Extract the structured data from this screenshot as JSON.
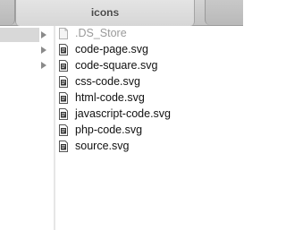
{
  "window": {
    "title": "icons"
  },
  "files": [
    {
      "name": ".DS_Store",
      "hidden": true,
      "icon": "blank-document-icon"
    },
    {
      "name": "code-page.svg",
      "hidden": false,
      "icon": "svg-document-icon"
    },
    {
      "name": "code-square.svg",
      "hidden": false,
      "icon": "svg-document-icon"
    },
    {
      "name": "css-code.svg",
      "hidden": false,
      "icon": "svg-document-icon"
    },
    {
      "name": "html-code.svg",
      "hidden": false,
      "icon": "svg-document-icon"
    },
    {
      "name": "javascript-code.svg",
      "hidden": false,
      "icon": "svg-document-icon"
    },
    {
      "name": "php-code.svg",
      "hidden": false,
      "icon": "svg-document-icon"
    },
    {
      "name": "source.svg",
      "hidden": false,
      "icon": "svg-document-icon"
    }
  ],
  "colors": {
    "selection_gray": "#d8d8d8",
    "text": "#111111",
    "hidden_text": "#9a9a9a"
  }
}
